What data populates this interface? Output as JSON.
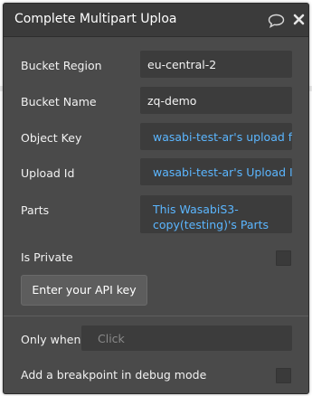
{
  "dialog": {
    "title": "Complete Multipart Uploa",
    "comment_icon": "speech-bubble-icon",
    "close_icon": "close-x-icon"
  },
  "fields": {
    "bucket_region": {
      "label": "Bucket Region",
      "value": "eu-central-2"
    },
    "bucket_name": {
      "label": "Bucket Name",
      "value": "zq-demo"
    },
    "object_key": {
      "label": "Object Key",
      "value": "wasabi-test-ar's upload file"
    },
    "upload_id": {
      "label": "Upload Id",
      "value": "wasabi-test-ar's Upload ID"
    },
    "parts": {
      "label": "Parts",
      "value": "This WasabiS3-copy(testing)'s Parts"
    }
  },
  "is_private": {
    "label": "Is Private",
    "checked": false
  },
  "api_key_button": {
    "label": "Enter your API key"
  },
  "only_when": {
    "label": "Only when",
    "placeholder": "Click"
  },
  "breakpoint": {
    "label": "Add a breakpoint in debug mode",
    "checked": false
  },
  "colors": {
    "panel_bg": "#4a4a4a",
    "header_bg": "#3b3b3b",
    "field_bg": "#3c3c3c",
    "dynamic_text": "#5bb6ff"
  }
}
